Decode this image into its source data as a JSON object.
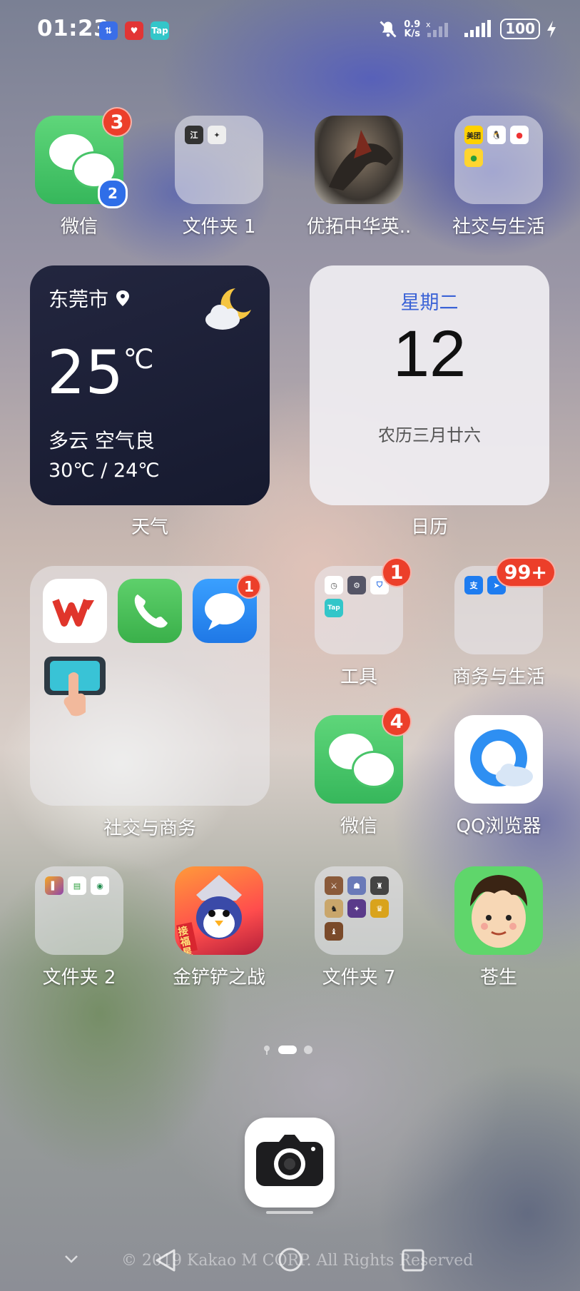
{
  "status_bar": {
    "time": "01:23",
    "notif_icons": [
      "download-icon",
      "heart-app-icon",
      "taptap-icon"
    ],
    "taptap_label": "Tap",
    "net_speed_value": "0.9",
    "net_speed_unit": "K/s",
    "battery": "100"
  },
  "row1": [
    {
      "label": "微信",
      "badge": "3",
      "clone_badge": "2"
    },
    {
      "label": "文件夹 1"
    },
    {
      "label": "优拓中华英.."
    },
    {
      "label": "社交与生活",
      "mini": {
        "meituan": "美团"
      }
    }
  ],
  "weather": {
    "city": "东莞市",
    "temp": "25",
    "unit": "℃",
    "desc": "多云 空气良",
    "range": "30℃ / 24℃",
    "label": "天气"
  },
  "calendar": {
    "weekday": "星期二",
    "day": "12",
    "lunar": "农历三月廿六",
    "label": "日历"
  },
  "big_folder": {
    "label": "社交与商务",
    "message_badge": "1"
  },
  "row_tools": [
    {
      "label": "工具",
      "badge": "1",
      "tap_label": "Tap"
    },
    {
      "label": "商务与生活",
      "badge": "99+"
    }
  ],
  "row_apps2": [
    {
      "label": "微信",
      "badge": "4"
    },
    {
      "label": "QQ浏览器"
    }
  ],
  "row_bottom": [
    {
      "label": "文件夹 2"
    },
    {
      "label": "金铲铲之战",
      "banner": "接福星"
    },
    {
      "label": "文件夹 7"
    },
    {
      "label": "苍生"
    }
  ],
  "watermark": "© 2019 Kakao M CORP. All Rights Reserved",
  "colors": {
    "badge": "#ec3f2a",
    "wechat": "#36b75b",
    "weekday": "#3b63d6",
    "weather_bg": "#1b1f35"
  }
}
